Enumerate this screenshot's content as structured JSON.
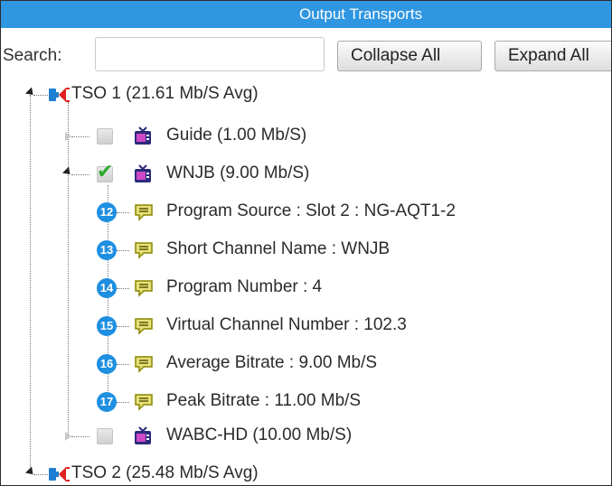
{
  "panel": {
    "title": "Output Transports"
  },
  "toolbar": {
    "search_label": "Search:",
    "search_value": "",
    "collapse_label": "Collapse All",
    "expand_label": "Expand All"
  },
  "tree": {
    "transports": [
      {
        "label": "TSO 1 (21.61 Mb/S Avg)",
        "expanded": true,
        "programs": [
          {
            "label": "Guide (1.00 Mb/S)",
            "checked": false,
            "expanded": false
          },
          {
            "label": "WNJB (9.00 Mb/S)",
            "checked": true,
            "expanded": true,
            "properties": [
              {
                "badge": "12",
                "label": "Program Source : Slot 2 : NG-AQT1-2"
              },
              {
                "badge": "13",
                "label": "Short Channel Name : WNJB"
              },
              {
                "badge": "14",
                "label": "Program Number : 4"
              },
              {
                "badge": "15",
                "label": "Virtual Channel Number : 102.3"
              },
              {
                "badge": "16",
                "label": "Average Bitrate : 9.00 Mb/S"
              },
              {
                "badge": "17",
                "label": "Peak Bitrate : 11.00 Mb/S"
              }
            ]
          },
          {
            "label": "WABC-HD (10.00 Mb/S)",
            "checked": false,
            "expanded": false
          }
        ]
      },
      {
        "label": "TSO 2 (25.48 Mb/S Avg)",
        "expanded": true
      }
    ]
  },
  "colors": {
    "title_bar": "#2f96e2",
    "badge": "#1e8fe1",
    "transport_icon": "#1e7fd0",
    "transport_plug": "#e02020",
    "checkmark": "#2fa82f",
    "tv_icon": "#2a2a7a",
    "property_icon": "#c9c400"
  },
  "icons": {
    "transport": "connector-plug-icon",
    "program": "tv-icon",
    "property": "speech-bubble-icon",
    "expanded": "triangle-down-icon",
    "collapsed": "triangle-right-icon"
  }
}
